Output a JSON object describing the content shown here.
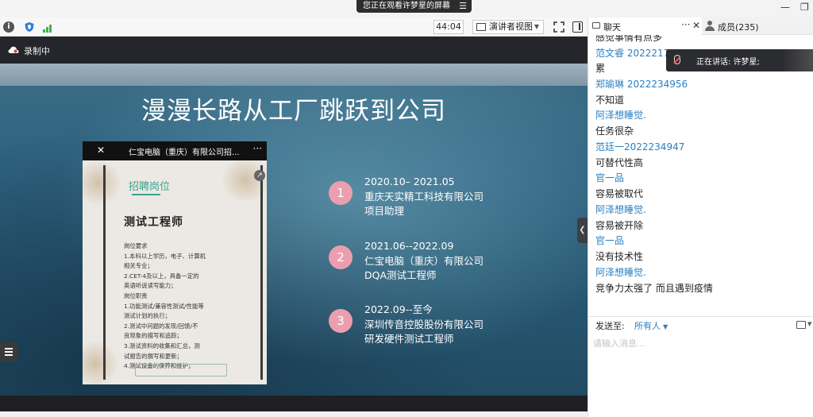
{
  "banner": {
    "text": "您正在观看许梦星的屏幕"
  },
  "toolbar": {
    "timer": "44:04",
    "view_mode": "演讲者视图"
  },
  "recording": {
    "label": "录制中"
  },
  "slide": {
    "title": "漫漫长路从工厂跳跃到公司",
    "phone": {
      "title": "仁宝电脑（重庆）有限公司招...",
      "heading": "招聘岗位",
      "job_title": "测试工程师",
      "body_lines": [
        "岗位要求",
        "1.本科以上学历，电子、计算机",
        "相关专业；",
        "2.CET-4及以上，具备一定的",
        "英语听说读写能力；",
        "岗位职责",
        "1.功能测试/兼容性测试/性能等",
        "测试计划的执行；",
        "2.测试中问题的发现/回馈/不",
        "良现象的描写和追踪；",
        "3.测试资料的收集和汇总，测",
        "试报告的撰写和更新；",
        "4.测试设备的保养和维护；"
      ]
    },
    "timeline": [
      {
        "num": "1",
        "lines": [
          "2020.10– 2021.05",
          "重庆天实精工科技有限公司",
          "项目助理"
        ]
      },
      {
        "num": "2",
        "lines": [
          "2021.06--2022.09",
          "仁宝电脑（重庆）有限公司",
          "DQA测试工程师"
        ]
      },
      {
        "num": "3",
        "lines": [
          "2022.09--至今",
          "深圳传音控股股份有限公司",
          "研发硬件测试工程师"
        ]
      }
    ]
  },
  "panel": {
    "tab_chat": "聊天",
    "tab_members": "成员(235)",
    "messages": [
      {
        "kind": "text",
        "text": "感觉事情有点多"
      },
      {
        "kind": "sender",
        "text": "范文睿 20222170"
      },
      {
        "kind": "text",
        "text": "累"
      },
      {
        "kind": "sender",
        "text": "郑瑜琳 2022234956"
      },
      {
        "kind": "text",
        "text": "不知道"
      },
      {
        "kind": "sender",
        "text": "阿泽想睡觉."
      },
      {
        "kind": "text",
        "text": "任务很杂"
      },
      {
        "kind": "sender",
        "text": "范廷一2022234947"
      },
      {
        "kind": "text",
        "text": "可替代性高"
      },
      {
        "kind": "sender",
        "text": "官一品"
      },
      {
        "kind": "text",
        "text": "容易被取代"
      },
      {
        "kind": "sender",
        "text": "阿泽想睡觉."
      },
      {
        "kind": "text",
        "text": "容易被开除"
      },
      {
        "kind": "sender",
        "text": "官一品"
      },
      {
        "kind": "text",
        "text": "没有技术性"
      },
      {
        "kind": "sender",
        "text": "阿泽想睡觉."
      },
      {
        "kind": "text",
        "text": "竞争力太强了 而且遇到疫情"
      }
    ],
    "speaking": "正在讲话: 许梦星;",
    "send_to_label": "发送至:",
    "send_to_value": "所有人",
    "input_placeholder": "请输入消息..."
  }
}
